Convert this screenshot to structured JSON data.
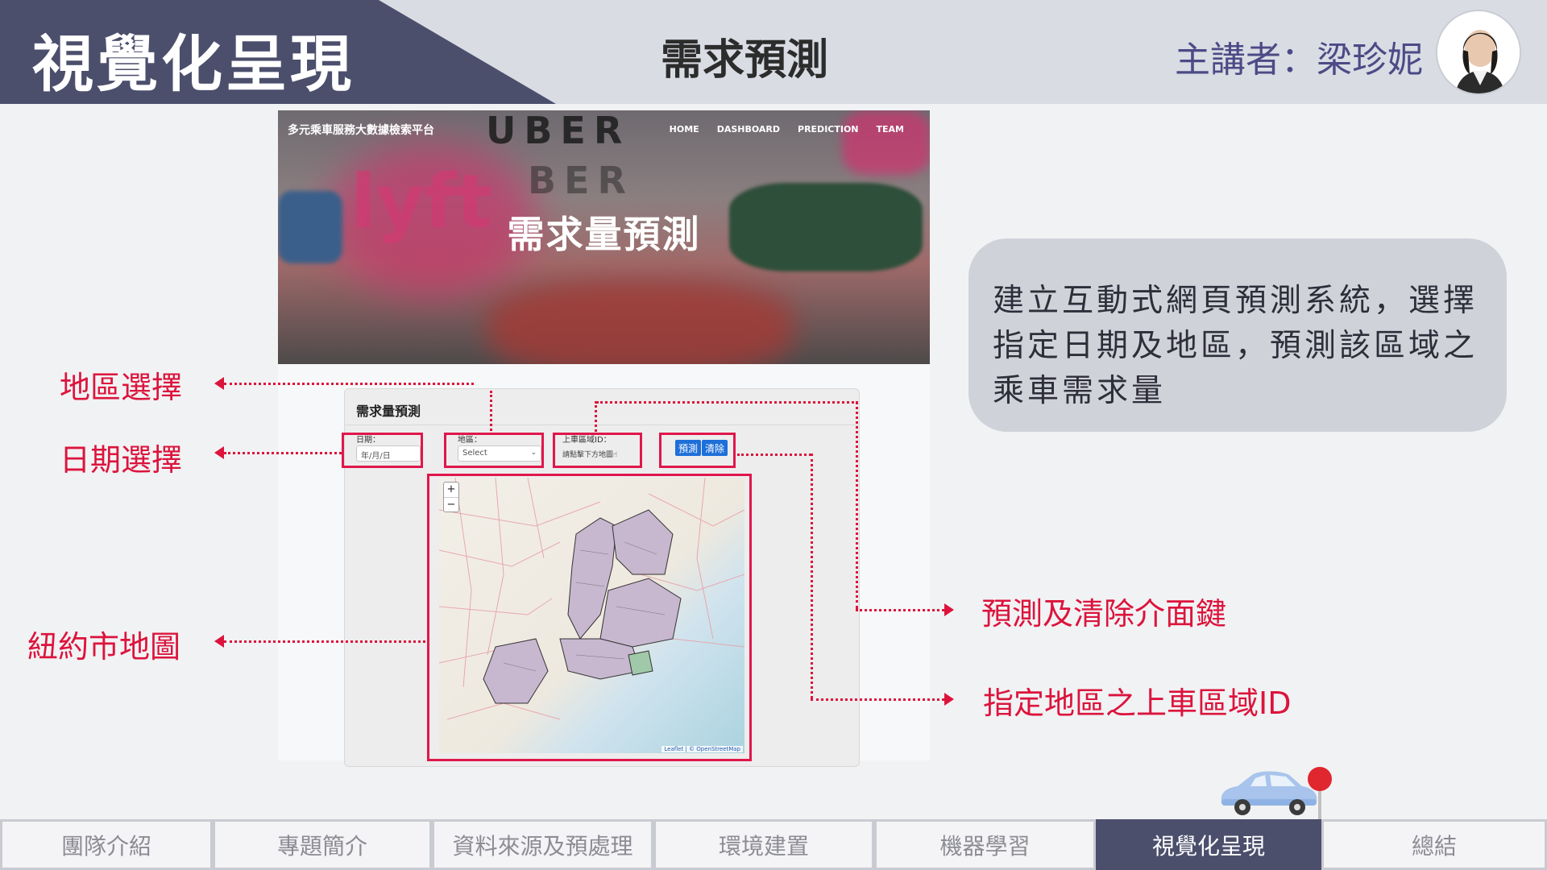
{
  "header": {
    "section_title": "視覺化呈現",
    "page_title": "需求預測",
    "presenter": "主講者：梁珍妮"
  },
  "screenshot": {
    "site_title": "多元乘車服務大數據檢索平台",
    "nav": [
      "HOME",
      "DASHBOARD",
      "PREDICTION",
      "TEAM"
    ],
    "hero_heading": "需求量預測",
    "hero_words": [
      "UBER",
      "BER",
      "lyft"
    ],
    "panel_title": "需求量預測",
    "date_label": "日期：",
    "date_placeholder": "年/月/日",
    "region_label": "地區：",
    "region_selected": "Select",
    "pickup_label": "上車區域ID：",
    "pickup_hint": "請點擊下方地圖",
    "predict_button": "預測",
    "clear_button": "清除",
    "map_zoom_in": "+",
    "map_zoom_out": "−",
    "map_attribution": "Leaflet | © OpenStreetMap"
  },
  "annotations": {
    "region_select": "地區選擇",
    "date_select": "日期選擇",
    "nyc_map": "紐約市地圖",
    "predict_clear": "預測及清除介面鍵",
    "pickup_id": "指定地區之上車區域ID"
  },
  "description": "建立互動式網頁預測系統，選擇指定日期及地區，預測該區域之乘車需求量",
  "tabs": [
    {
      "label": "團隊介紹",
      "active": false
    },
    {
      "label": "專題簡介",
      "active": false
    },
    {
      "label": "資料來源及預處理",
      "active": false
    },
    {
      "label": "環境建置",
      "active": false
    },
    {
      "label": "機器學習",
      "active": false
    },
    {
      "label": "視覺化呈現",
      "active": true
    },
    {
      "label": "總結",
      "active": false
    }
  ],
  "colors": {
    "accent_red": "#dc143c",
    "header_dark": "#4b4f6c",
    "presenter_purple": "#4c4a86"
  }
}
